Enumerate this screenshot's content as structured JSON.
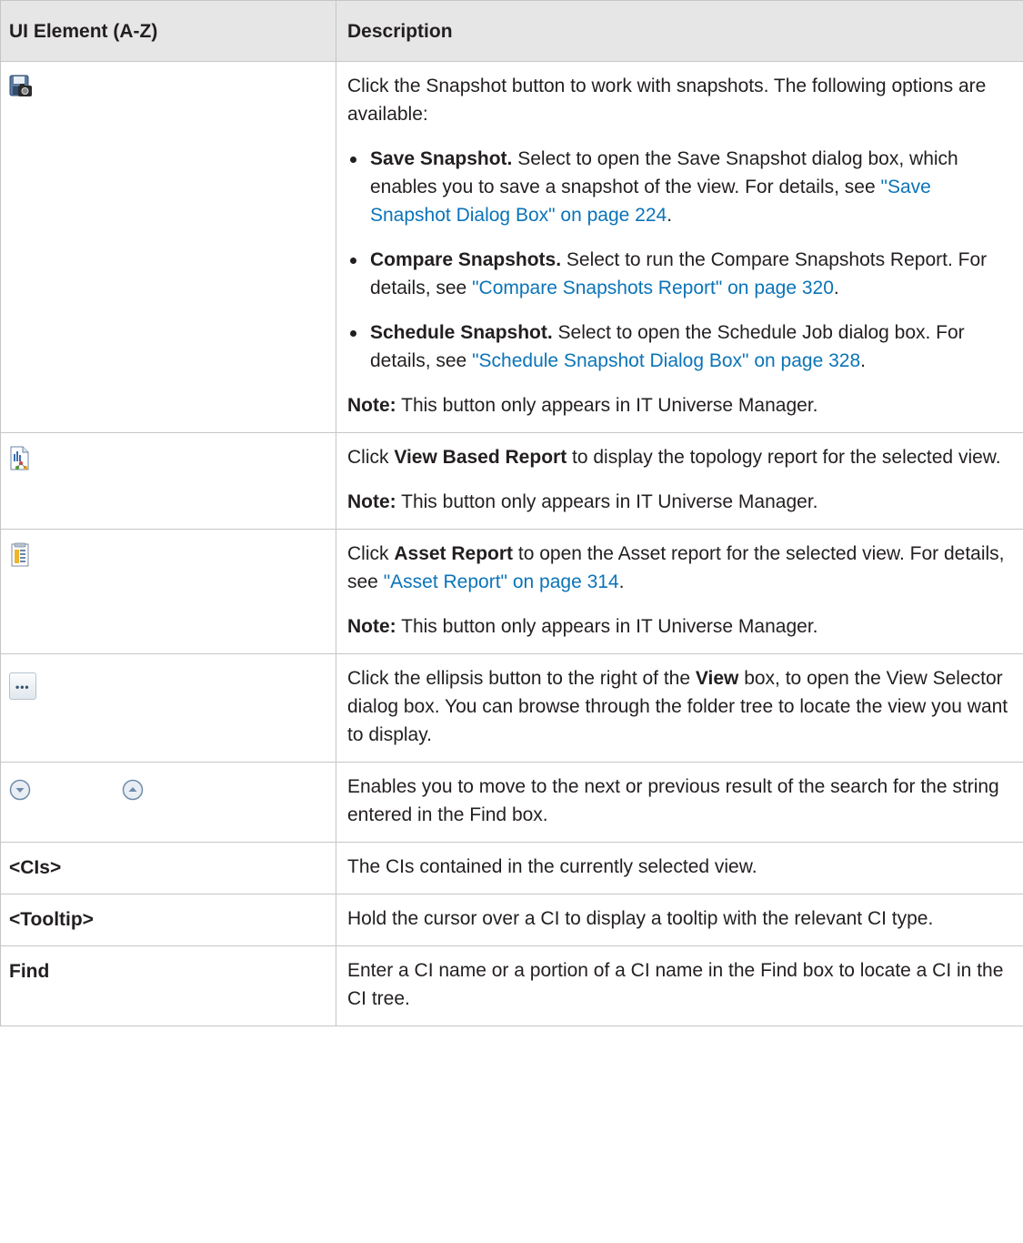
{
  "header": {
    "col1": "UI Element (A-Z)",
    "col2": "Description"
  },
  "rows": {
    "snapshot": {
      "icon": "snapshot-icon",
      "intro": "Click the Snapshot button to work with snapshots. The following options are available:",
      "options": [
        {
          "bold": "Save Snapshot.",
          "text": " Select to open the Save Snapshot dialog box, which enables you to save a snapshot of the view. For details, see ",
          "link": "\"Save Snapshot Dialog Box\" on page 224",
          "after": "."
        },
        {
          "bold": "Compare Snapshots.",
          "text": " Select to run the Compare Snapshots Report. For details, see ",
          "link": "\"Compare Snapshots Report\" on page 320",
          "after": "."
        },
        {
          "bold": "Schedule Snapshot.",
          "text": " Select to open the Schedule Job dialog box. For details, see ",
          "link": "\"Schedule Snapshot Dialog Box\" on page 328",
          "after": "."
        }
      ],
      "note_label": "Note:",
      "note_text": " This button only appears in IT Universe Manager."
    },
    "view_report": {
      "icon": "view-based-report-icon",
      "pre": "Click ",
      "bold": "View Based Report",
      "post": " to display the topology report for the selected view.",
      "note_label": "Note:",
      "note_text": " This button only appears in IT Universe Manager."
    },
    "asset_report": {
      "icon": "asset-report-icon",
      "pre": "Click ",
      "bold": "Asset Report",
      "post": " to open the Asset report for the selected view. For details, see ",
      "link": "\"Asset Report\" on page 314",
      "after": ".",
      "note_label": "Note:",
      "note_text": " This button only appears in IT Universe Manager."
    },
    "ellipsis": {
      "icon": "ellipsis-button-icon",
      "pre": "Click the ellipsis button to the right of the ",
      "bold": "View",
      "post": " box, to open the View Selector dialog box. You can browse through the folder tree to locate the view you want to display."
    },
    "navigate": {
      "icon_next": "next-result-icon",
      "icon_prev": "previous-result-icon",
      "text": "Enables you to move to the next or previous result of the search for the string entered in the Find box."
    },
    "cis": {
      "element": "<CIs>",
      "text": "The CIs contained in the currently selected view."
    },
    "tooltip": {
      "element": "<Tooltip>",
      "text": "Hold the cursor over a CI to display a tooltip with the relevant CI type."
    },
    "find": {
      "element": "Find",
      "text": "Enter a CI name or a portion of a CI name in the Find box to locate a CI in the CI tree."
    }
  },
  "colors": {
    "link": "#0b74b8",
    "header_bg": "#e6e6e6",
    "border": "#c6c6c6"
  }
}
